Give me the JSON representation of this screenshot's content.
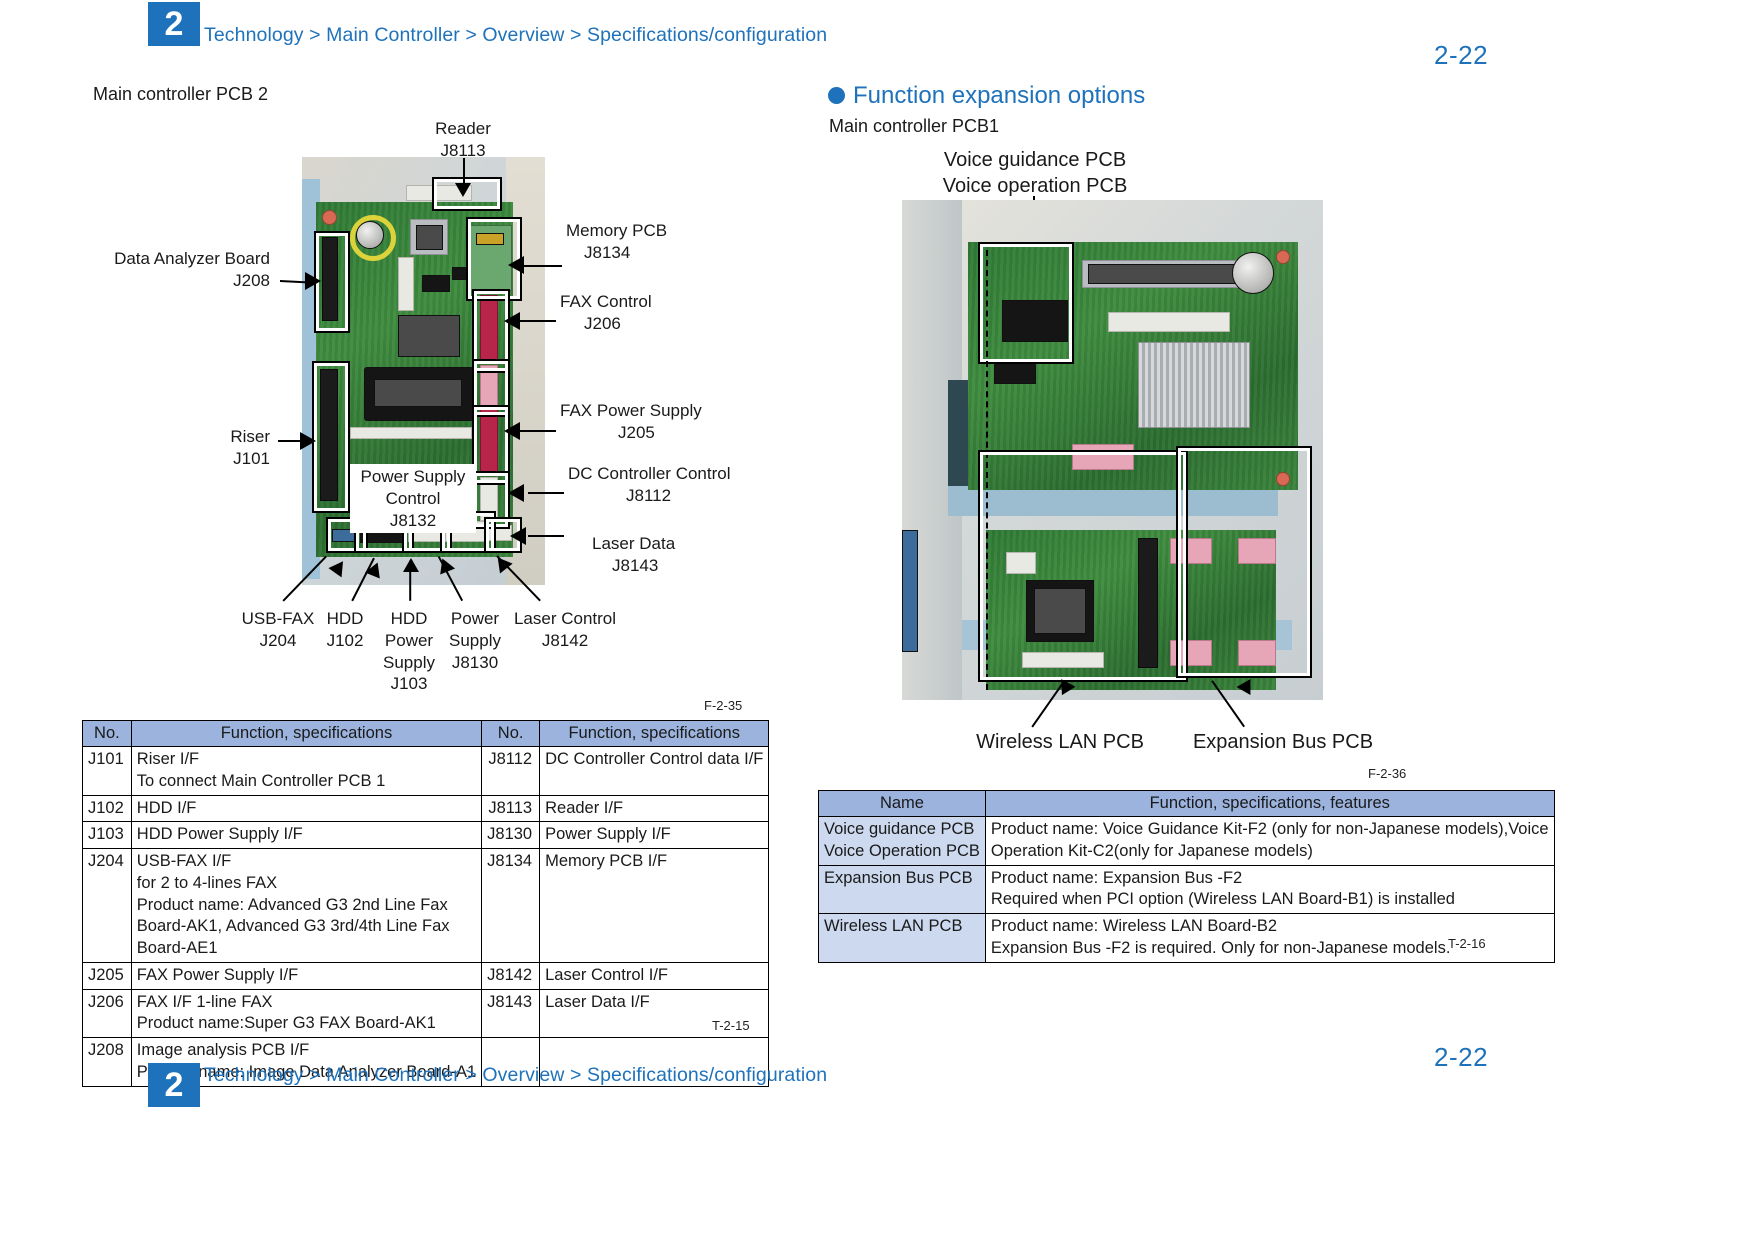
{
  "header": {
    "chapter": "2",
    "breadcrumb": "Technology > Main Controller > Overview > Specifications/configuration",
    "page_number": "2-22"
  },
  "footer": {
    "chapter": "2",
    "breadcrumb": "Technology > Main Controller > Overview > Specifications/configuration",
    "page_number": "2-22"
  },
  "left": {
    "heading": "Main controller PCB 2",
    "figure_caption": "F-2-35",
    "table_caption": "T-2-15",
    "callouts": {
      "reader": {
        "line1": "Reader",
        "line2": "J8113"
      },
      "data_analyzer": {
        "line1": "Data Analyzer Board",
        "line2": "J208"
      },
      "riser": {
        "line1": "Riser",
        "line2": "J101"
      },
      "power_supply_control": {
        "line1": "Power Supply",
        "line2": "Control",
        "line3": "J8132"
      },
      "memory_pcb": {
        "line1": "Memory PCB",
        "line2": "J8134"
      },
      "fax_control": {
        "line1": "FAX Control",
        "line2": "J206"
      },
      "fax_power_supply": {
        "line1": "FAX Power Supply",
        "line2": "J205"
      },
      "dc_controller_control": {
        "line1": "DC Controller Control",
        "line2": "J8112"
      },
      "laser_data": {
        "line1": "Laser Data",
        "line2": "J8143"
      },
      "usb_fax": {
        "line1": "USB-FAX",
        "line2": "J204"
      },
      "hdd": {
        "line1": "HDD",
        "line2": "J102"
      },
      "hdd_power_supply": {
        "line1": "HDD",
        "line2": "Power",
        "line3": "Supply",
        "line4": "J103"
      },
      "power_supply": {
        "line1": "Power",
        "line2": "Supply",
        "line3": "J8130"
      },
      "laser_control": {
        "line1": "Laser Control",
        "line2": "J8142"
      }
    },
    "table": {
      "headers": [
        "No.",
        "Function, specifications",
        "No.",
        "Function, specifications"
      ],
      "rows": [
        {
          "no_a": "J101",
          "spec_a": [
            "Riser I/F",
            "To connect Main Controller PCB 1"
          ],
          "no_b": "J8112",
          "spec_b": [
            "DC Controller Control data I/F"
          ]
        },
        {
          "no_a": "J102",
          "spec_a": [
            "HDD I/F"
          ],
          "no_b": "J8113",
          "spec_b": [
            "Reader I/F"
          ]
        },
        {
          "no_a": "J103",
          "spec_a": [
            "HDD Power Supply I/F"
          ],
          "no_b": "J8130",
          "spec_b": [
            "Power Supply I/F"
          ]
        },
        {
          "no_a": "J204",
          "spec_a": [
            "USB-FAX I/F",
            "for 2 to 4-lines FAX",
            "Product name: Advanced G3 2nd Line Fax",
            "Board-AK1, Advanced G3 3rd/4th Line Fax",
            "Board-AE1"
          ],
          "no_b": "J8134",
          "spec_b": [
            "Memory PCB I/F"
          ]
        },
        {
          "no_a": "J205",
          "spec_a": [
            "FAX Power Supply I/F"
          ],
          "no_b": "J8142",
          "spec_b": [
            "Laser Control I/F"
          ]
        },
        {
          "no_a": "J206",
          "spec_a": [
            "FAX I/F 1-line FAX",
            "Product name:Super G3 FAX Board-AK1"
          ],
          "no_b": "J8143",
          "spec_b": [
            "Laser Data I/F"
          ]
        },
        {
          "no_a": "J208",
          "spec_a": [
            "Image analysis PCB I/F",
            "Product name: Image Data Analyzer Board-A1"
          ],
          "no_b": "",
          "spec_b": [
            ""
          ]
        }
      ]
    }
  },
  "right": {
    "section_title": "Function expansion options",
    "heading": "Main controller PCB1",
    "figure_caption": "F-2-36",
    "table_caption": "T-2-16",
    "callouts": {
      "voice_top": {
        "line1": "Voice guidance PCB",
        "line2": "Voice operation PCB"
      },
      "wireless_lan": {
        "line1": "Wireless LAN PCB"
      },
      "expansion_bus": {
        "line1": "Expansion Bus  PCB"
      }
    },
    "table": {
      "headers": [
        "Name",
        "Function, specifications, features"
      ],
      "rows": [
        {
          "name": [
            "Voice guidance PCB",
            "Voice Operation PCB"
          ],
          "spec": [
            "Product name: Voice Guidance Kit-F2 (only for non-Japanese models),Voice",
            "Operation Kit-C2(only for Japanese models)"
          ]
        },
        {
          "name": [
            "Expansion Bus PCB"
          ],
          "spec": [
            "Product name: Expansion Bus -F2",
            "Required when PCI option (Wireless LAN Board-B1) is installed"
          ]
        },
        {
          "name": [
            "Wireless LAN PCB"
          ],
          "spec": [
            "Product name: Wireless LAN Board-B2",
            "Expansion Bus -F2 is required. Only for non-Japanese models."
          ]
        }
      ]
    }
  },
  "colors": {
    "accent": "#1e72bb",
    "table_header": "#9bb3dd",
    "table_name_cell": "#ccd9ef"
  }
}
